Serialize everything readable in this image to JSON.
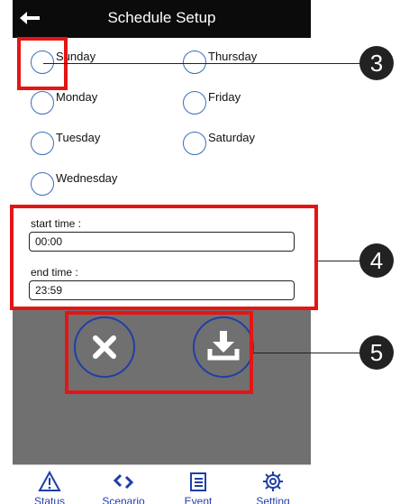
{
  "header": {
    "title": "Schedule Setup"
  },
  "days": [
    {
      "label": "Sunday"
    },
    {
      "label": "Thursday"
    },
    {
      "label": "Monday"
    },
    {
      "label": "Friday"
    },
    {
      "label": "Tuesday"
    },
    {
      "label": "Saturday"
    },
    {
      "label": "Wednesday"
    }
  ],
  "time": {
    "start_label": "start time :",
    "start_value": "00:00",
    "end_label": "end time :",
    "end_value": "23:59"
  },
  "tabs": [
    {
      "label": "Status"
    },
    {
      "label": "Scenario"
    },
    {
      "label": "Event"
    },
    {
      "label": "Setting"
    }
  ],
  "callouts": [
    "3",
    "4",
    "5"
  ],
  "colors": {
    "accent": "#1f3fa6",
    "highlight": "#e51515",
    "titlebar": "#0b0b0b",
    "action_panel": "#707070"
  }
}
